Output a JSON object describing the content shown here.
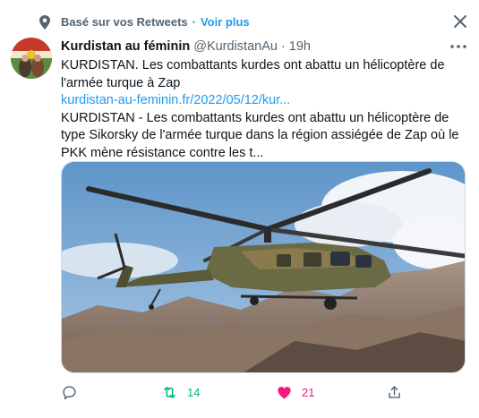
{
  "context": {
    "label": "Basé sur vos Retweets",
    "separator": "·",
    "link": "Voir plus"
  },
  "tweet": {
    "author_name": "Kurdistan au féminin",
    "author_handle": "@KurdistanAu",
    "dot": "·",
    "time": "19h",
    "body_line1": "KURDISTAN. Les combattants kurdes ont abattu un hélicoptère de l'armée turque à Zap",
    "link_text": "kurdistan-au-feminin.fr/2022/05/12/kur...",
    "body_line2": "KURDISTAN - Les combattants kurdes ont abattu un hélicoptère de type Sikorsky de l'armée turque dans la région assiégée de Zap où le PKK mène résistance contre les t..."
  },
  "actions": {
    "retweets": "14",
    "likes": "21"
  },
  "colors": {
    "accent": "#1d9bf0",
    "retweet": "#00ba7c",
    "like": "#f91880",
    "muted": "#536471"
  }
}
